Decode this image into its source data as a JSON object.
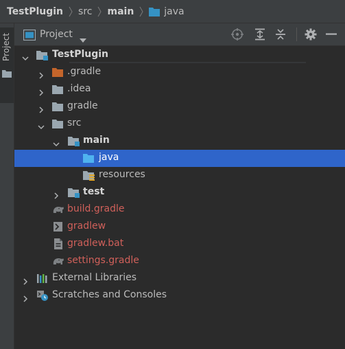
{
  "breadcrumb": {
    "items": [
      "TestPlugin",
      "src",
      "main",
      "java"
    ]
  },
  "side_tab": {
    "label": "Project"
  },
  "tool_window": {
    "title": "Project"
  },
  "tree": [
    {
      "label": "TestPlugin",
      "style": "bold",
      "depth": 0,
      "expanded": true,
      "icon": "module-folder-icon"
    },
    {
      "label": ".gradle",
      "style": "normal",
      "depth": 1,
      "expanded": false,
      "icon": "folder-orange-icon"
    },
    {
      "label": ".idea",
      "style": "normal",
      "depth": 1,
      "expanded": false,
      "icon": "folder-icon"
    },
    {
      "label": "gradle",
      "style": "normal",
      "depth": 1,
      "expanded": false,
      "icon": "folder-icon"
    },
    {
      "label": "src",
      "style": "normal",
      "depth": 1,
      "expanded": true,
      "icon": "folder-icon"
    },
    {
      "label": "main",
      "style": "bold",
      "depth": 2,
      "expanded": true,
      "icon": "source-set-folder-icon"
    },
    {
      "label": "java",
      "style": "normal",
      "depth": 3,
      "selected": true,
      "icon": "source-root-folder-icon"
    },
    {
      "label": "resources",
      "style": "normal",
      "depth": 3,
      "icon": "resources-folder-icon"
    },
    {
      "label": "test",
      "style": "bold",
      "depth": 2,
      "expanded": false,
      "icon": "source-set-folder-icon"
    },
    {
      "label": "build.gradle",
      "style": "gradle",
      "depth": 1,
      "icon": "gradle-elephant-icon"
    },
    {
      "label": "gradlew",
      "style": "gradle",
      "depth": 1,
      "icon": "shell-script-icon"
    },
    {
      "label": "gradlew.bat",
      "style": "gradle",
      "depth": 1,
      "icon": "bat-file-icon"
    },
    {
      "label": "settings.gradle",
      "style": "gradle",
      "depth": 1,
      "icon": "gradle-elephant-icon"
    },
    {
      "label": "External Libraries",
      "style": "normal",
      "depth": 0,
      "expanded": false,
      "icon": "libraries-icon"
    },
    {
      "label": "Scratches and Consoles",
      "style": "normal",
      "depth": 0,
      "expanded": false,
      "icon": "scratches-icon"
    }
  ],
  "colors": {
    "background": "#2b2b2b",
    "panel": "#3c3f41",
    "selection": "#2f65ca",
    "gradle_file_text": "#d0605a",
    "source_blue": "#3592c4",
    "excluded_orange": "#c4652b"
  }
}
